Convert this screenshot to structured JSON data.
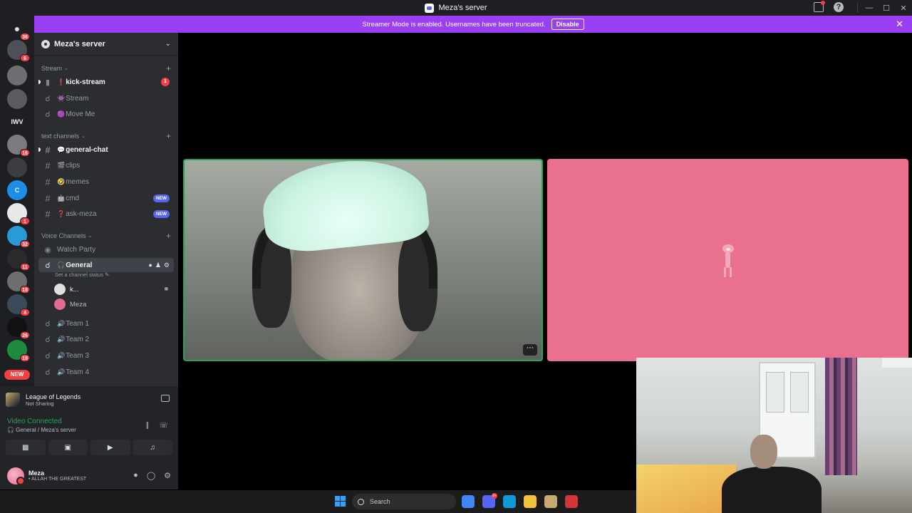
{
  "window": {
    "title": "Meza's server"
  },
  "banner": {
    "message": "Streamer Mode is enabled. Usernames have been truncated.",
    "disable_label": "Disable"
  },
  "rail": {
    "dm_badge": "36",
    "servers": [
      {
        "badge": "6",
        "color": "#4e5058"
      },
      {
        "badge": "",
        "color": "#6d6f73"
      },
      {
        "badge": "",
        "color": "#5a5c60"
      },
      {
        "label": "IWV",
        "badge": "",
        "color": "#1e1f22"
      },
      {
        "badge": "16",
        "color": "#7a7c80"
      },
      {
        "badge": "",
        "color": "#3b3d41"
      },
      {
        "label": "C",
        "badge": "",
        "color": "#1d8ee8"
      },
      {
        "badge": "1",
        "color": "#e8e8e8"
      },
      {
        "badge": "32",
        "color": "#2a9ad6"
      },
      {
        "badge": "11",
        "color": "#2b2b2b"
      },
      {
        "badge": "18",
        "color": "#6f6f6f"
      },
      {
        "badge": "4",
        "color": "#3a4c5c"
      },
      {
        "badge": "26",
        "color": "#111111"
      },
      {
        "badge": "19",
        "color": "#1f8a3e"
      }
    ],
    "new_badge": "NEW"
  },
  "server_header": {
    "name": "Meza's server"
  },
  "categories": {
    "stream": "Stream",
    "text": "text channels",
    "voice": "Voice Channels"
  },
  "channels": {
    "kick_stream": {
      "name": "kick-stream",
      "emoji": "❗",
      "count": "1"
    },
    "stream": {
      "name": "Stream",
      "emoji": "👾"
    },
    "move_me": {
      "name": "Move Me",
      "emoji": "🟣"
    },
    "general_chat": {
      "name": "general-chat",
      "emoji": "💬"
    },
    "clips": {
      "name": "clips",
      "emoji": "🎬"
    },
    "memes": {
      "name": "memes",
      "emoji": "🤣"
    },
    "cmd": {
      "name": "cmd",
      "emoji": "🤖",
      "tag": "NEW"
    },
    "ask_meza": {
      "name": "ask-meza",
      "emoji": "❓",
      "tag": "NEW"
    },
    "watch_party": {
      "name": "Watch Party"
    },
    "general_voice": {
      "name": "General",
      "emoji": "🎧",
      "status_hint": "Set a channel status"
    },
    "team1": {
      "name": "Team 1",
      "emoji": "🔊"
    },
    "team2": {
      "name": "Team 2",
      "emoji": "🔊"
    },
    "team3": {
      "name": "Team 3",
      "emoji": "🔊"
    },
    "team4": {
      "name": "Team 4",
      "emoji": "🔊"
    }
  },
  "voice_users": [
    {
      "name": "k...",
      "color": "#e0e0e0"
    },
    {
      "name": "Meza",
      "color": "#e36b8f"
    }
  ],
  "activity": {
    "game": "League of Legends",
    "sharing": "Not Sharing"
  },
  "voice_connection": {
    "status": "Video Connected",
    "location": "🎧 General / Meza's server"
  },
  "user": {
    "name": "Meza",
    "status": "• ALLAH THE GREATEST"
  },
  "taskbar": {
    "search_placeholder": "Search",
    "apps": [
      {
        "name": "chrome-app",
        "color": "#4285f4"
      },
      {
        "name": "discord-app",
        "color": "#5865f2",
        "badge": "9+"
      },
      {
        "name": "edge-app",
        "color": "#0f9bd7"
      },
      {
        "name": "explorer-app",
        "color": "#f3c23a"
      },
      {
        "name": "league-app",
        "color": "#c8aa6e"
      },
      {
        "name": "riot-app",
        "color": "#d13639"
      }
    ]
  },
  "colors": {
    "streamer_banner": "#9b3ff5",
    "speaking_ring": "#23a55a",
    "pink_tile": "#e9718f",
    "mention": "#f23f43"
  }
}
